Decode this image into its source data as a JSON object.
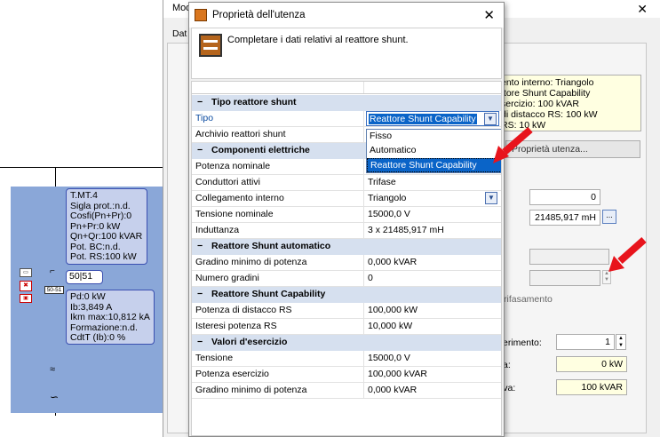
{
  "background_window": {
    "title_partial": "Mod",
    "tab_partial": "Dat",
    "info_lines": [
      "ento interno: Triangolo",
      "ttore Shunt Capability",
      "sercizio: 100 kVAR",
      "di distacco RS: 100 kW",
      "RS: 10 kW"
    ],
    "properties_button": "Proprietà utenza...",
    "field_zero": "0",
    "inductance_field": "21485,917 mH",
    "ellipsis_button": "...",
    "rifasamento_label": "rifasamento",
    "riferimento_label": "erimento:",
    "riferimento_value": "1",
    "a_label": "a:",
    "a_value": "0 kW",
    "iva_label": "tiva:",
    "iva_value": "100 kVAR"
  },
  "schematic": {
    "node_title": "T.MT.4",
    "lines_top": [
      "Sigla prot.:n.d.",
      "Cosfi(Pn+Pr):0",
      "Pn+Pr:0 kW",
      "Qn+Qr:100 kVAR",
      "Pot. BC:n.d.",
      "Pot. RS:100 kW"
    ],
    "protection_code": "50|51",
    "relay_label": "50-51",
    "lines_bottom": [
      "Pd:0 kW",
      "Ib:3,849 A",
      "Ikm max:10,812 kA",
      "Formazione:n.d.",
      "CdtT (Ib):0 %"
    ]
  },
  "dialog": {
    "title": "Proprietà dell'utenza",
    "close_glyph": "✕",
    "hint": "Completare i dati relativi al reattore shunt.",
    "dropdown_options": [
      "Fisso",
      "Automatico",
      "Reattore Shunt Capability"
    ],
    "dropdown_selected_index": 2,
    "sections": [
      {
        "type": "cat",
        "label": "Tipo reattore shunt"
      },
      {
        "type": "row",
        "key": "Tipo",
        "value": "Reattore Shunt Capability",
        "combo": true,
        "highlight": true
      },
      {
        "type": "row",
        "key": "Archivio reattori shunt",
        "value": ""
      },
      {
        "type": "cat",
        "label": "Componenti elettriche"
      },
      {
        "type": "row",
        "key": "Potenza nominale",
        "value": ""
      },
      {
        "type": "row",
        "key": "Conduttori attivi",
        "value": "Trifase"
      },
      {
        "type": "row",
        "key": "Collegamento interno",
        "value": "Triangolo",
        "combo": true
      },
      {
        "type": "row",
        "key": "Tensione nominale",
        "value": "15000,0 V"
      },
      {
        "type": "row",
        "key": "Induttanza",
        "value": "3 x 21485,917 mH"
      },
      {
        "type": "cat",
        "label": "Reattore Shunt automatico"
      },
      {
        "type": "row",
        "key": "Gradino minimo di potenza",
        "value": "0,000 kVAR"
      },
      {
        "type": "row",
        "key": "Numero gradini",
        "value": "0"
      },
      {
        "type": "cat",
        "label": "Reattore Shunt Capability"
      },
      {
        "type": "row",
        "key": "Potenza di distacco RS",
        "value": "100,000 kW"
      },
      {
        "type": "row",
        "key": "Isteresi potenza RS",
        "value": "10,000 kW"
      },
      {
        "type": "cat",
        "label": "Valori d'esercizio"
      },
      {
        "type": "row",
        "key": "Tensione",
        "value": "15000,0 V"
      },
      {
        "type": "row",
        "key": "Potenza esercizio",
        "value": "100,000 kVAR"
      },
      {
        "type": "row",
        "key": "Gradino minimo di potenza",
        "value": "0,000 kVAR"
      }
    ]
  },
  "colors": {
    "accent": "#0a64c8",
    "category_bg": "#d6e0ef",
    "arrow": "#e8141c"
  }
}
